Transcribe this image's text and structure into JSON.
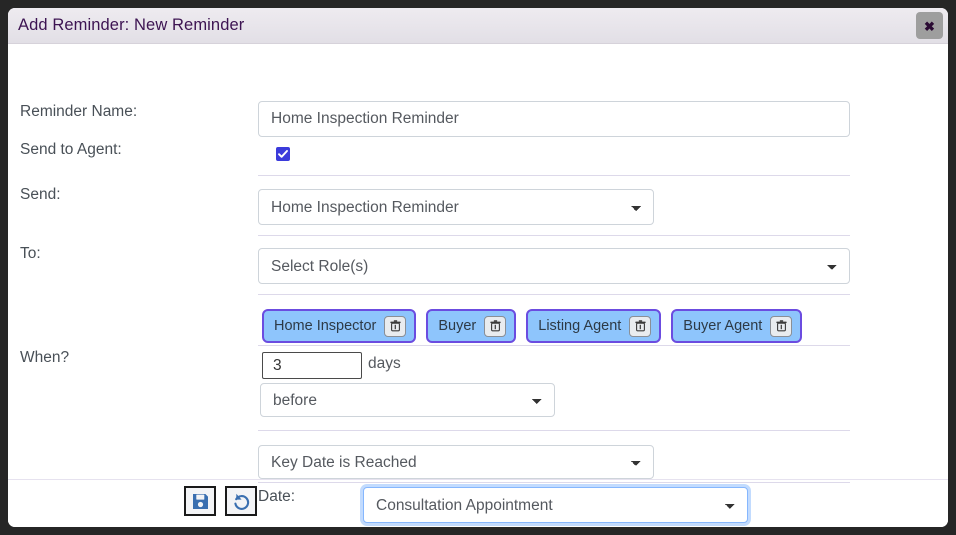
{
  "dialog": {
    "title": "Add Reminder: New Reminder",
    "close_label": "✖",
    "close_icon": "close-icon"
  },
  "form": {
    "reminder_name": {
      "label": "Reminder Name:",
      "value": "Home Inspection Reminder",
      "placeholder": ""
    },
    "send_to_agent": {
      "label": "Send to Agent:",
      "checked": true
    },
    "send": {
      "label": "Send:",
      "value": "Home Inspection Reminder"
    },
    "to": {
      "label": "To:",
      "value": "Select Role(s)"
    },
    "roles": [
      {
        "label": "Home Inspector",
        "delete_icon": "trash-icon"
      },
      {
        "label": "Buyer",
        "delete_icon": "trash-icon"
      },
      {
        "label": "Listing Agent",
        "delete_icon": "trash-icon"
      },
      {
        "label": "Buyer Agent",
        "delete_icon": "trash-icon"
      }
    ],
    "when": {
      "label": "When?",
      "days_value": "3",
      "days_unit": "days",
      "offset_direction": "before",
      "trigger": "Key Date is Reached"
    },
    "date": {
      "label": "Date:",
      "value": "Consultation Appointment"
    }
  },
  "footer": {
    "save": {
      "name": "save-button",
      "icon": "save-floppy-icon"
    },
    "reset": {
      "name": "reset-button",
      "icon": "undo-arrow-icon"
    }
  },
  "colors": {
    "titlebar": "#e6e3e8",
    "title_text": "#3d1452",
    "tag_bg": "#8ec5fc",
    "tag_border": "#6b4ce0",
    "checkbox": "#3b3bdb",
    "focus_ring": "#86b7fe",
    "icon_blue": "#3a6fb0",
    "backdrop": "#262626"
  }
}
